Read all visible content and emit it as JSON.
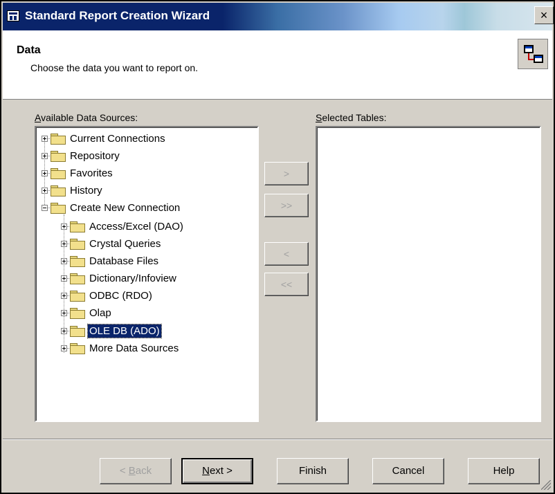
{
  "window": {
    "title": "Standard Report Creation Wizard",
    "close_glyph": "×"
  },
  "header": {
    "title": "Data",
    "subtitle": "Choose the data you want to report on."
  },
  "available": {
    "label_key": "A",
    "label_rest": "vailable Data Sources:",
    "items": [
      {
        "label": "Current Connections"
      },
      {
        "label": "Repository"
      },
      {
        "label": "Favorites"
      },
      {
        "label": "History"
      },
      {
        "label": "Create New Connection"
      },
      {
        "label": "Access/Excel (DAO)"
      },
      {
        "label": "Crystal Queries"
      },
      {
        "label": "Database Files"
      },
      {
        "label": "Dictionary/Infoview"
      },
      {
        "label": "ODBC (RDO)"
      },
      {
        "label": "Olap"
      },
      {
        "label": "OLE DB (ADO)"
      },
      {
        "label": "More Data Sources"
      }
    ]
  },
  "selected": {
    "label_key": "S",
    "label_rest": "elected Tables:"
  },
  "transfer": {
    "add": ">",
    "add_all": ">>",
    "remove": "<",
    "remove_all": "<<"
  },
  "footer": {
    "back_prefix": "< ",
    "back_key": "B",
    "back_rest": "ack",
    "next_key": "N",
    "next_rest": "ext >",
    "finish": "Finish",
    "cancel": "Cancel",
    "help": "Help"
  },
  "colors": {
    "title_start": "#0a246a",
    "selection": "#0a246a",
    "dialog_bg": "#d4d0c8"
  }
}
